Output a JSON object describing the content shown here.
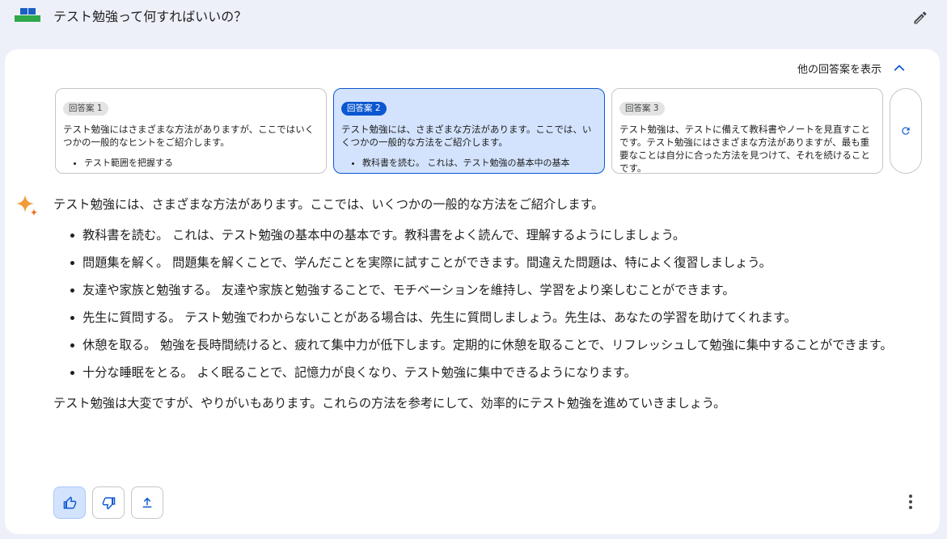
{
  "header": {
    "title": "テスト勉強って何すればいいの？",
    "avatar_icon": "user-avatar-icon",
    "edit_icon": "pencil-icon"
  },
  "drafts": {
    "toggle_label": "他の回答案を表示",
    "toggle_icon": "chevron-up-icon",
    "items": [
      {
        "label": "回答案 1",
        "text": "テスト勉強にはさまざまな方法がありますが、ここではいくつかの一般的なヒントをご紹介します。",
        "bullet": "テスト範囲を把握する"
      },
      {
        "label": "回答案 2",
        "text": "テスト勉強には、さまざまな方法があります。ここでは、いくつかの一般的な方法をご紹介します。",
        "bullet": "教科書を読む。 これは、テスト勉強の基本中の基本"
      },
      {
        "label": "回答案 3",
        "text": "テスト勉強は、テストに備えて教科書やノートを見直すことです。テスト勉強にはさまざまな方法がありますが、最も重要なことは自分に合った方法を見つけて、それを続けることです。",
        "bullet": ""
      }
    ],
    "regenerate_icon": "refresh-icon"
  },
  "response": {
    "intro": "テスト勉強には、さまざまな方法があります。ここでは、いくつかの一般的な方法をご紹介します。",
    "bullets": [
      "教科書を読む。 これは、テスト勉強の基本中の基本です。教科書をよく読んで、理解するようにしましょう。",
      "問題集を解く。 問題集を解くことで、学んだことを実際に試すことができます。間違えた問題は、特によく復習しましょう。",
      "友達や家族と勉強する。 友達や家族と勉強することで、モチベーションを維持し、学習をより楽しむことができます。",
      "先生に質問する。 テスト勉強でわからないことがある場合は、先生に質問しましょう。先生は、あなたの学習を助けてくれます。",
      "休憩を取る。 勉強を長時間続けると、疲れて集中力が低下します。定期的に休憩を取ることで、リフレッシュして勉強に集中することができます。",
      "十分な睡眠をとる。 よく眠ることで、記憶力が良くなり、テスト勉強に集中できるようになります。"
    ],
    "outro": "テスト勉強は大変ですが、やりがいもあります。これらの方法を参考にして、効率的にテスト勉強を進めていきましょう。"
  },
  "actions": {
    "icons": [
      "thumbs-up-icon",
      "thumbs-down-icon",
      "share-icon",
      "more-vert-icon"
    ],
    "accent": "#0b57d0",
    "selected_bg": "#d3e3fd"
  }
}
